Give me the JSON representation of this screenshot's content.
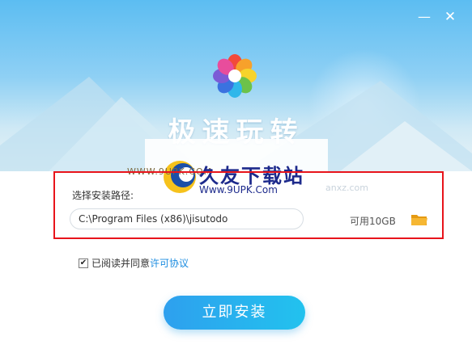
{
  "window": {
    "minimize_icon": "minimize-icon",
    "close_icon": "close-icon",
    "minimize_glyph": "—",
    "close_glyph": "✕"
  },
  "hero": {
    "app_name": "极速玩转",
    "logo_icon": "pinwheel-logo-icon",
    "logo_colors": [
      "#f24a3a",
      "#f7a12b",
      "#f6d32c",
      "#6cc24a",
      "#2fb7ea",
      "#3a72e0",
      "#7b5bd6",
      "#e84d9c"
    ]
  },
  "watermark": {
    "small_text": "WWW.9UPK.COM",
    "brand_cn": "久友下载站",
    "brand_url": "Www.9UPK.Com",
    "ghost_text": "anxz.com"
  },
  "install_path": {
    "label": "选择安装路径:",
    "value": "C:\\Program Files (x86)\\jisutodo",
    "free_space": "可用10GB",
    "folder_icon": "folder-icon"
  },
  "agreement": {
    "checked": true,
    "text": "已阅读并同意",
    "link": "许可协议"
  },
  "install_button": {
    "label": "立即安装"
  },
  "colors": {
    "highlight_border": "#e8141b",
    "primary": "#2ea0ee",
    "link": "#1b8ce0"
  }
}
